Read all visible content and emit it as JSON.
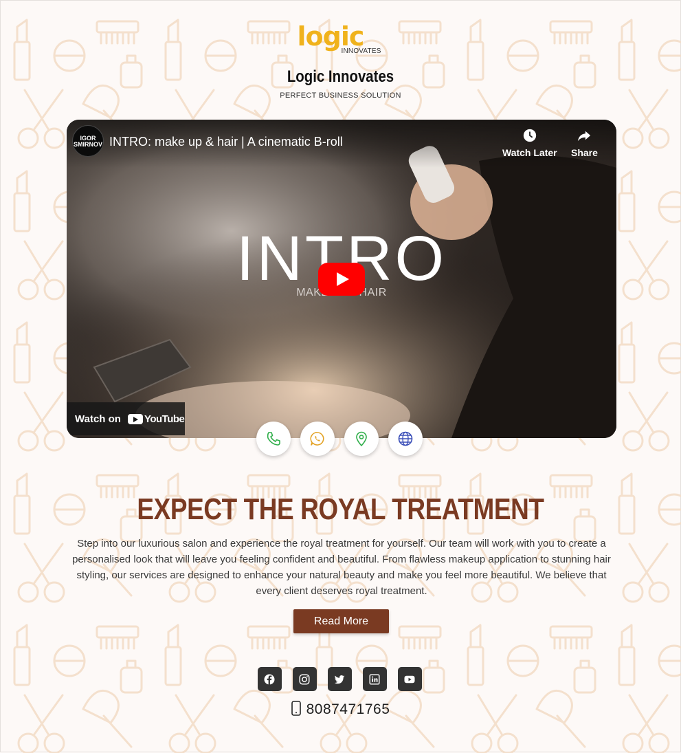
{
  "brand": {
    "logo_word": "logic",
    "logo_sub": "INNOVATES",
    "name": "Logic Innovates",
    "tagline": "PERFECT BUSINESS SOLUTION",
    "logo_color": "#f0b21c"
  },
  "video": {
    "title": "INTRO: make up & hair | A cinematic B-roll",
    "channel_avatar_text": "IGOR SMIRNOV",
    "watch_later": "Watch Later",
    "share": "Share",
    "overlay_title": "INTRO",
    "overlay_subtitle": "MAKEUP & HAIR",
    "watch_on": "Watch on",
    "youtube": "YouTube"
  },
  "contact_buttons": [
    {
      "name": "phone",
      "icon": "phone-icon",
      "color": "#2fae4a"
    },
    {
      "name": "whatsapp",
      "icon": "whatsapp-icon",
      "color": "#e3a326"
    },
    {
      "name": "location",
      "icon": "location-pin-icon",
      "color": "#2fae4a"
    },
    {
      "name": "website",
      "icon": "globe-icon",
      "color": "#3b4fb8"
    }
  ],
  "main": {
    "heading": "EXPECT THE ROYAL TREATMENT",
    "description": "Step into our luxurious salon and experience the royal treatment for yourself. Our team will work with you to create a personalised look that will leave you feeling confident and beautiful. From flawless makeup application to stunning hair styling, our services are designed to enhance your natural beauty and make you feel more beautiful. We believe that every client deserves royal treatment.",
    "read_more": "Read More",
    "accent": "#7a3a22"
  },
  "social": [
    {
      "name": "facebook",
      "icon": "facebook-icon"
    },
    {
      "name": "instagram",
      "icon": "instagram-icon"
    },
    {
      "name": "twitter",
      "icon": "twitter-icon"
    },
    {
      "name": "linkedin",
      "icon": "linkedin-icon"
    },
    {
      "name": "youtube",
      "icon": "youtube-icon"
    }
  ],
  "footer": {
    "phone": "8087471765"
  }
}
